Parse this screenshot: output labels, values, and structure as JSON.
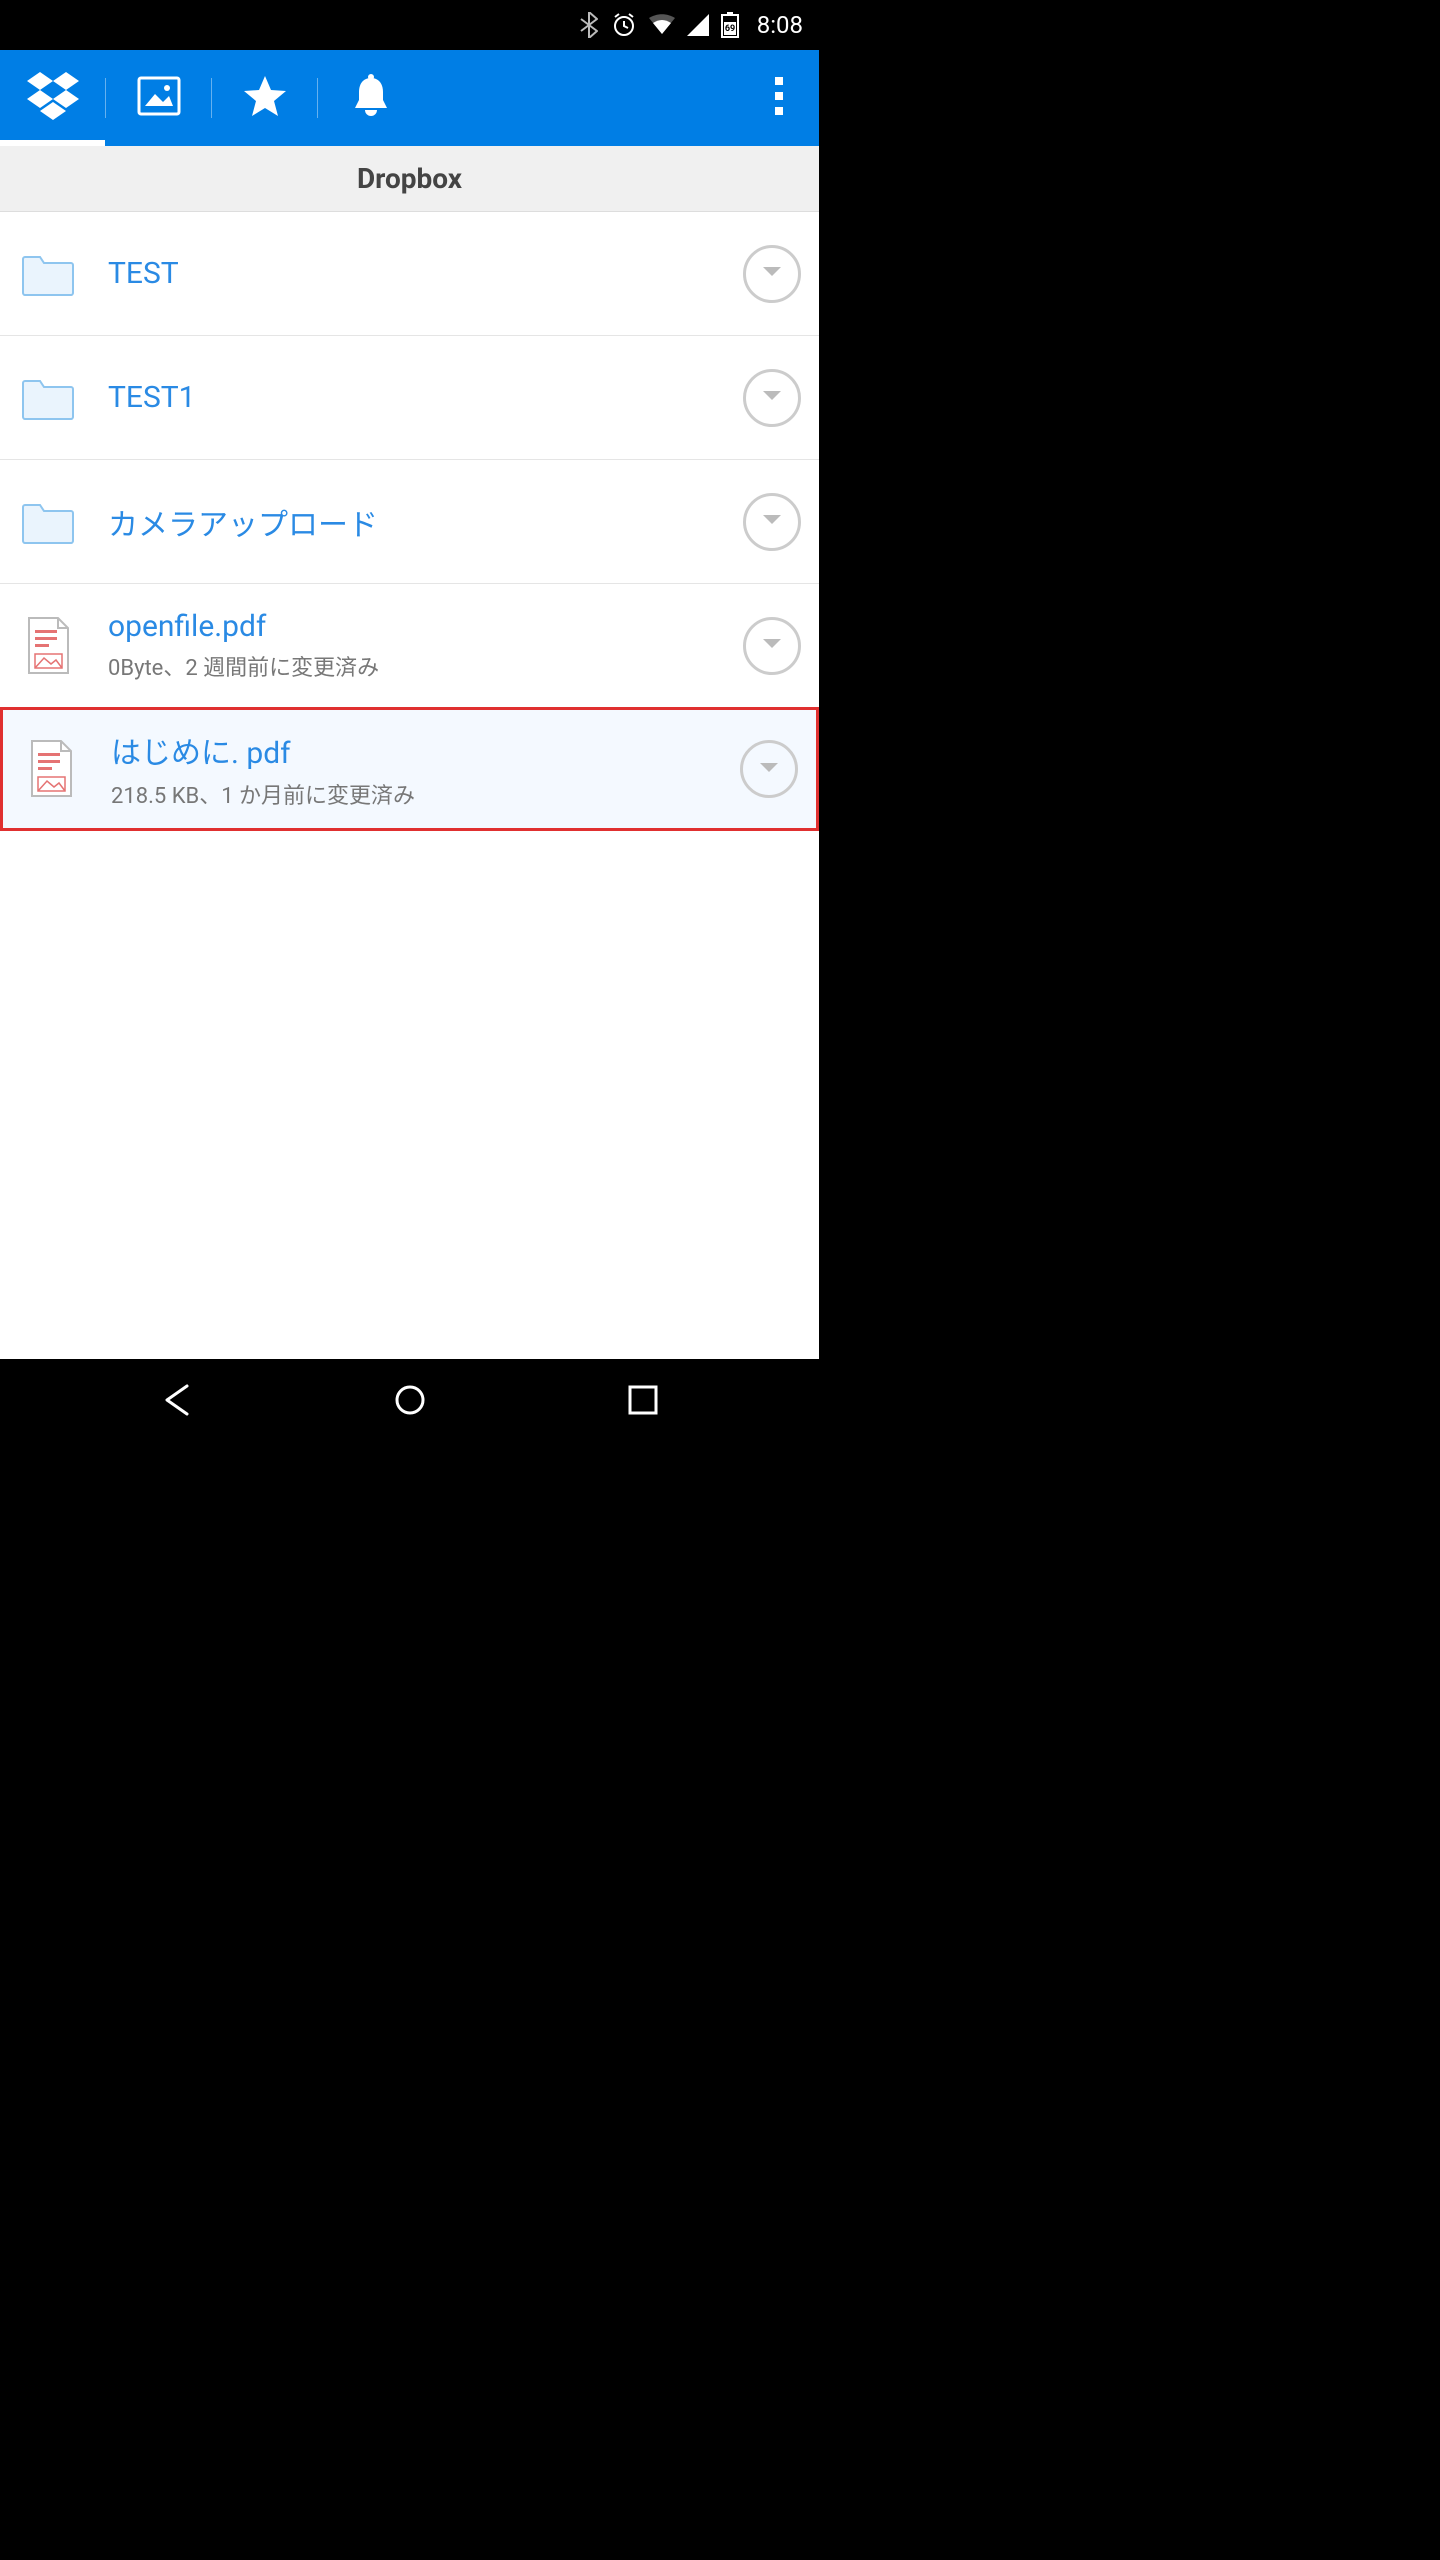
{
  "status_bar": {
    "time": "8:08",
    "battery_text": "69"
  },
  "section": {
    "title": "Dropbox"
  },
  "tabs": {
    "active_index": 0
  },
  "files": [
    {
      "type": "folder",
      "name": "TEST",
      "meta": "",
      "selected": false
    },
    {
      "type": "folder",
      "name": "TEST1",
      "meta": "",
      "selected": false
    },
    {
      "type": "folder",
      "name": "カメラアップロード",
      "meta": "",
      "selected": false
    },
    {
      "type": "pdf",
      "name": "openfile.pdf",
      "meta": "0Byte、2 週間前に変更済み",
      "selected": false
    },
    {
      "type": "pdf",
      "name": "はじめに. pdf",
      "meta": "218.5 KB、1 か月前に変更済み",
      "selected": true
    }
  ],
  "icons": {
    "dropbox": "dropbox-icon",
    "photos": "photos-icon",
    "favorites": "star-icon",
    "notifications": "bell-icon",
    "overflow": "overflow-icon"
  }
}
